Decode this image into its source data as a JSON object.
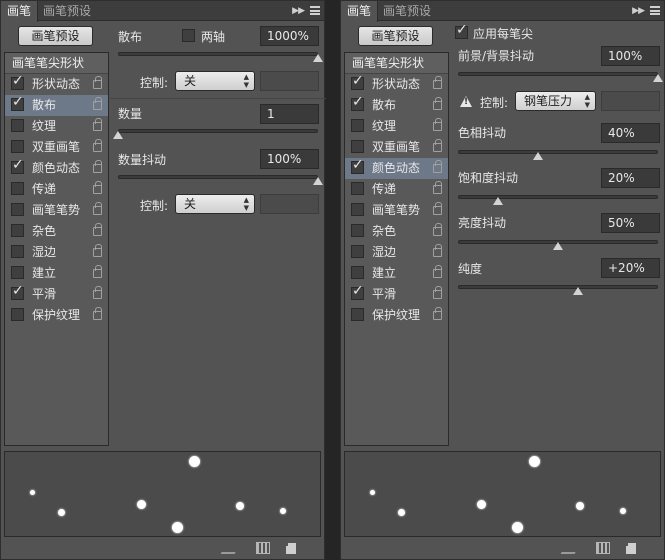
{
  "left": {
    "tabs": [
      "画笔",
      "画笔预设"
    ],
    "preset_button": "画笔预设",
    "list_header": "画笔笔尖形状",
    "items": [
      {
        "label": "形状动态",
        "checked": true,
        "selected": false
      },
      {
        "label": "散布",
        "checked": true,
        "selected": true
      },
      {
        "label": "纹理",
        "checked": false,
        "selected": false
      },
      {
        "label": "双重画笔",
        "checked": false,
        "selected": false
      },
      {
        "label": "颜色动态",
        "checked": true,
        "selected": false
      },
      {
        "label": "传递",
        "checked": false,
        "selected": false
      },
      {
        "label": "画笔笔势",
        "checked": false,
        "selected": false
      },
      {
        "label": "杂色",
        "checked": false,
        "selected": false
      },
      {
        "label": "湿边",
        "checked": false,
        "selected": false
      },
      {
        "label": "建立",
        "checked": false,
        "selected": false
      },
      {
        "label": "平滑",
        "checked": true,
        "selected": false
      },
      {
        "label": "保护纹理",
        "checked": false,
        "selected": false
      }
    ],
    "scatter": {
      "label": "散布",
      "both_axes_label": "两轴",
      "both_axes_checked": false,
      "value": "1000%",
      "slider_fraction": 1.0
    },
    "control_label": "控制:",
    "control1_value": "关",
    "count": {
      "label": "数量",
      "value": "1",
      "slider_fraction": 0.0
    },
    "count_jitter": {
      "label": "数量抖动",
      "value": "100%",
      "slider_fraction": 1.0
    },
    "control2_value": "关"
  },
  "right": {
    "tabs": [
      "画笔",
      "画笔预设"
    ],
    "apply_per_tip_label": "应用每笔尖",
    "apply_per_tip_checked": true,
    "preset_button": "画笔预设",
    "list_header": "画笔笔尖形状",
    "items": [
      {
        "label": "形状动态",
        "checked": true,
        "selected": false
      },
      {
        "label": "散布",
        "checked": true,
        "selected": false
      },
      {
        "label": "纹理",
        "checked": false,
        "selected": false
      },
      {
        "label": "双重画笔",
        "checked": false,
        "selected": false
      },
      {
        "label": "颜色动态",
        "checked": true,
        "selected": true
      },
      {
        "label": "传递",
        "checked": false,
        "selected": false
      },
      {
        "label": "画笔笔势",
        "checked": false,
        "selected": false
      },
      {
        "label": "杂色",
        "checked": false,
        "selected": false
      },
      {
        "label": "湿边",
        "checked": false,
        "selected": false
      },
      {
        "label": "建立",
        "checked": false,
        "selected": false
      },
      {
        "label": "平滑",
        "checked": true,
        "selected": false
      },
      {
        "label": "保护纹理",
        "checked": false,
        "selected": false
      }
    ],
    "fg_bg_jitter": {
      "label": "前景/背景抖动",
      "value": "100%",
      "slider_fraction": 1.0
    },
    "control_label": "控制:",
    "control_value": "钢笔压力",
    "hue_jitter": {
      "label": "色相抖动",
      "value": "40%",
      "slider_fraction": 0.4
    },
    "saturation_jitter": {
      "label": "饱和度抖动",
      "value": "20%",
      "slider_fraction": 0.2
    },
    "brightness_jitter": {
      "label": "亮度抖动",
      "value": "50%",
      "slider_fraction": 0.5
    },
    "purity": {
      "label": "纯度",
      "value": "+20%",
      "slider_fraction": 0.6
    }
  },
  "icons": {
    "menu": "panel-menu-icon",
    "lock": "lock-icon",
    "warning": "warning-icon",
    "brush": "brush-tool-icon",
    "grid": "grid-toggle-icon",
    "new": "new-preset-icon"
  }
}
